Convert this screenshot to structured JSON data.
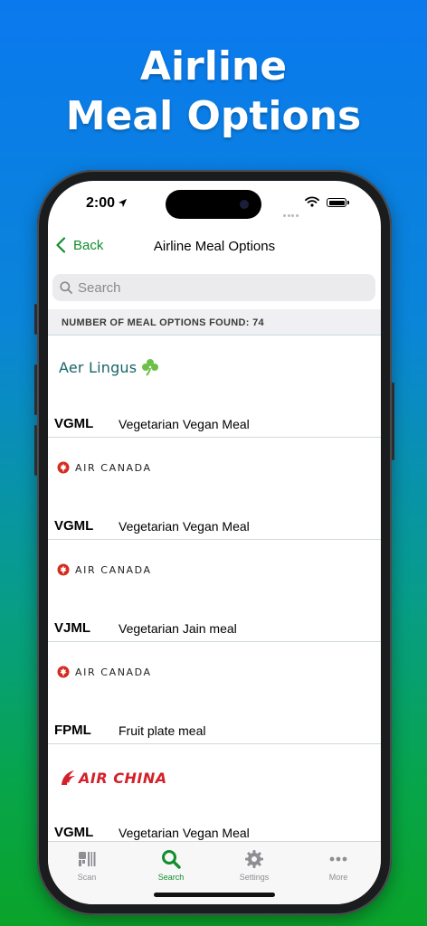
{
  "headline": {
    "line1": "Airline",
    "line2": "Meal Options"
  },
  "status_bar": {
    "time": "2:00"
  },
  "nav": {
    "back_label": "Back",
    "title": "Airline Meal Options"
  },
  "search": {
    "placeholder": "Search"
  },
  "section": {
    "header": "NUMBER OF MEAL OPTIONS FOUND: 74"
  },
  "meals": [
    {
      "airline_logo_text": "Aer Lingus",
      "code": "VGML",
      "description": "Vegetarian Vegan Meal"
    },
    {
      "airline_logo_text": "AIR CANADA",
      "code": "VGML",
      "description": "Vegetarian Vegan Meal"
    },
    {
      "airline_logo_text": "AIR CANADA",
      "code": "VJML",
      "description": "Vegetarian Jain meal"
    },
    {
      "airline_logo_text": "AIR CANADA",
      "code": "FPML",
      "description": "Fruit plate meal"
    },
    {
      "airline_logo_text": "AIR CHINA",
      "code": "VGML",
      "description": "Vegetarian Vegan Meal"
    }
  ],
  "tabs": [
    {
      "label": "Scan",
      "icon": "scan-icon"
    },
    {
      "label": "Search",
      "icon": "search-icon"
    },
    {
      "label": "Settings",
      "icon": "gear-icon"
    },
    {
      "label": "More",
      "icon": "more-icon"
    }
  ],
  "colors": {
    "accent": "#118e2e",
    "air_canada_red": "#d52b1e",
    "air_china_red": "#d4202a",
    "aer_lingus_teal": "#15656a",
    "aer_lingus_green": "#6cc04a"
  }
}
